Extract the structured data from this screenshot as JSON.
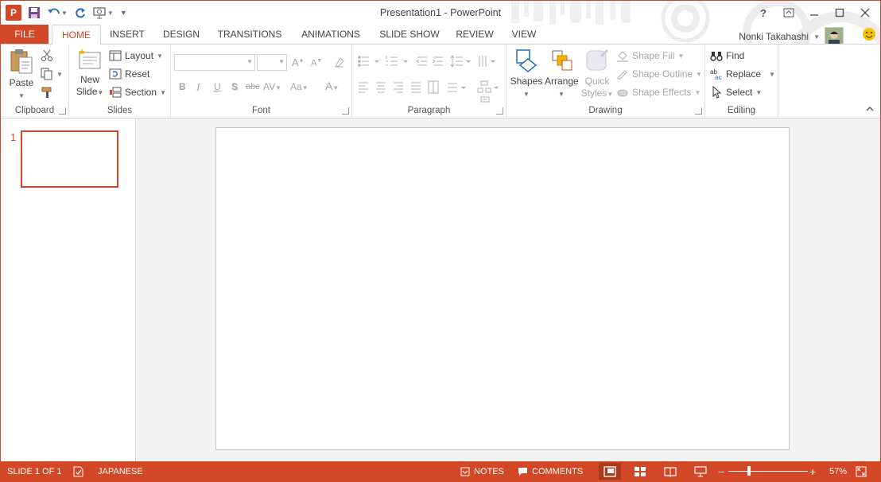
{
  "window": {
    "title": "Presentation1 - PowerPoint"
  },
  "qat": {
    "app_icon_letter": "P"
  },
  "tabs": [
    {
      "id": "file",
      "label": "FILE"
    },
    {
      "id": "home",
      "label": "HOME"
    },
    {
      "id": "insert",
      "label": "INSERT"
    },
    {
      "id": "design",
      "label": "DESIGN"
    },
    {
      "id": "transitions",
      "label": "TRANSITIONS"
    },
    {
      "id": "animations",
      "label": "ANIMATIONS"
    },
    {
      "id": "slideshow",
      "label": "SLIDE SHOW"
    },
    {
      "id": "review",
      "label": "REVIEW"
    },
    {
      "id": "view",
      "label": "VIEW"
    }
  ],
  "user": {
    "name": "Nonki Takahashi"
  },
  "ribbon": {
    "clipboard": {
      "label": "Clipboard",
      "paste": "Paste"
    },
    "slides": {
      "label": "Slides",
      "new_slide_line1": "New",
      "new_slide_line2": "Slide",
      "layout": "Layout",
      "reset": "Reset",
      "section": "Section"
    },
    "font": {
      "label": "Font",
      "bold": "B",
      "italic": "I",
      "underline": "U",
      "shadow": "S",
      "strike": "abc",
      "spacing": "AV",
      "case": "Aa",
      "color": "A",
      "grow": "A",
      "shrink": "A"
    },
    "paragraph": {
      "label": "Paragraph"
    },
    "drawing": {
      "label": "Drawing",
      "shapes": "Shapes",
      "arrange": "Arrange",
      "quick_line1": "Quick",
      "quick_line2": "Styles",
      "shape_fill": "Shape Fill",
      "shape_outline": "Shape Outline",
      "shape_effects": "Shape Effects"
    },
    "editing": {
      "label": "Editing",
      "find": "Find",
      "replace": "Replace",
      "select": "Select"
    }
  },
  "thumbnails": {
    "slide_number": "1"
  },
  "status": {
    "slide_info": "SLIDE 1 OF 1",
    "language": "JAPANESE",
    "notes": "NOTES",
    "comments": "COMMENTS",
    "zoom": "57%",
    "zoom_level_fraction": 0.57
  },
  "colors": {
    "accent": "#d24726",
    "status_dark": "#a83a1e"
  }
}
